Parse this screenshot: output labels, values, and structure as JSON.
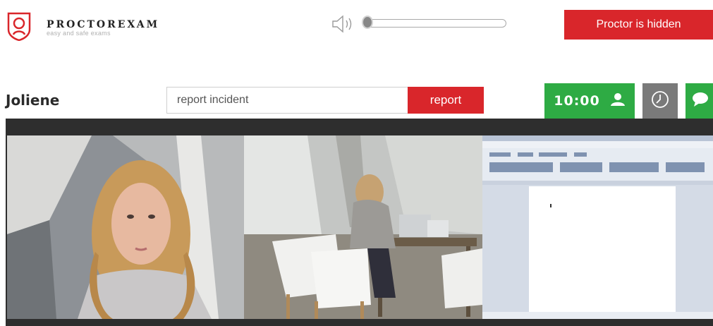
{
  "brand": {
    "name": "PROCTOREXAM",
    "tagline": "easy and safe exams"
  },
  "header": {
    "proctor_button_label": "Proctor is hidden",
    "volume_level": 0.0
  },
  "session": {
    "student_name": "Joliene",
    "incident_placeholder": "report incident",
    "report_button_label": "report",
    "timer_value": "10:00"
  },
  "feeds": [
    {
      "type": "webcam",
      "description_icon": "face-camera"
    },
    {
      "type": "room",
      "description_icon": "room-camera"
    },
    {
      "type": "screen",
      "description_icon": "screen-share"
    }
  ],
  "colors": {
    "accent_red": "#d9262b",
    "accent_green": "#2eab44",
    "neutral_gray": "#7a7a7a",
    "strip_dark": "#2e2e2e"
  }
}
